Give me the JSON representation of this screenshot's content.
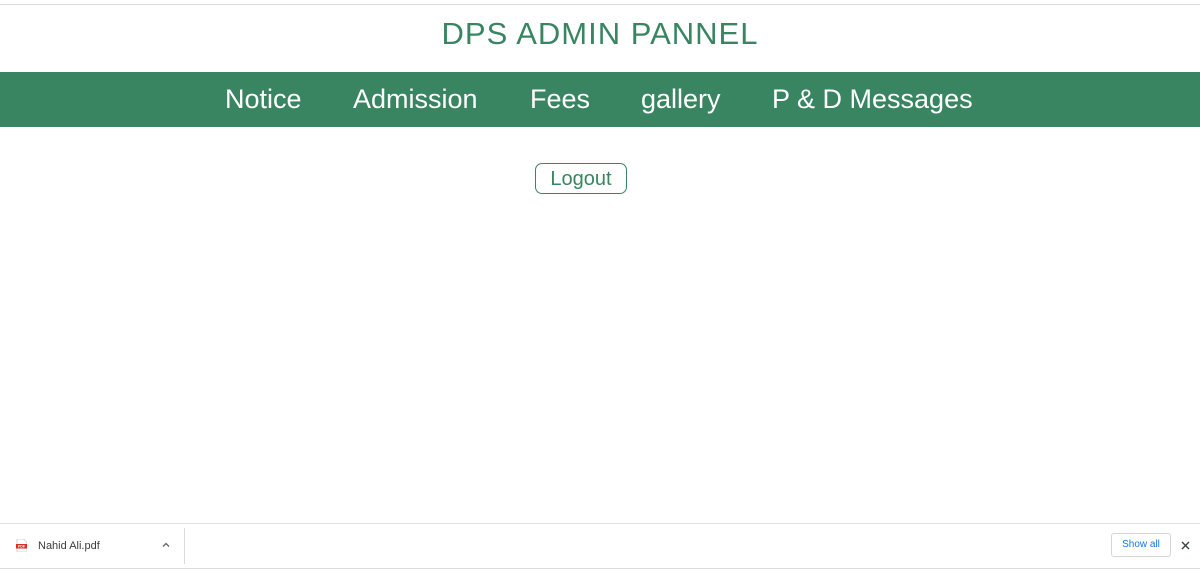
{
  "header": {
    "title": "DPS ADMIN PANNEL"
  },
  "nav": {
    "items": [
      {
        "label": "Notice"
      },
      {
        "label": "Admission"
      },
      {
        "label": "Fees"
      },
      {
        "label": "gallery"
      },
      {
        "label": "P & D Messages"
      }
    ]
  },
  "main": {
    "logout_label": "Logout"
  },
  "download_bar": {
    "file_name": "Nahid Ali.pdf",
    "file_icon": "pdf-file-icon",
    "show_all_label": "Show all"
  },
  "colors": {
    "brand_green": "#3a8561",
    "link_blue": "#1a73e8"
  }
}
